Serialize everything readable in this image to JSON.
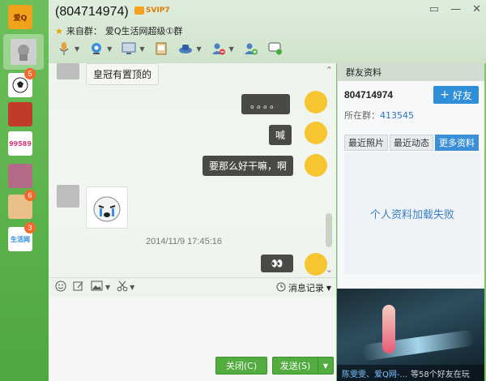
{
  "window": {
    "title": "(804714974)",
    "vip_label": "SVIP7",
    "subtitle_prefix": "来自群：",
    "subtitle_group": "爱Q生活网超级①群",
    "controls": [
      "▭",
      "—",
      "✕"
    ]
  },
  "rail": {
    "items": [
      {
        "label": "爱Q",
        "badge": ""
      },
      {
        "label": "",
        "badge": ""
      },
      {
        "label": "",
        "badge": "5"
      },
      {
        "label": "",
        "badge": ""
      },
      {
        "label": "99589",
        "badge": ""
      },
      {
        "label": "",
        "badge": ""
      },
      {
        "label": "",
        "badge": "6"
      },
      {
        "label": "生活网",
        "badge": "3"
      }
    ]
  },
  "chat": {
    "messages": [
      {
        "side": "left",
        "text": "皇冠有置顶的"
      },
      {
        "side": "right",
        "text": "。。。。"
      },
      {
        "side": "right",
        "text": "喊"
      },
      {
        "side": "right",
        "text": "要那么好干嘛，啊"
      },
      {
        "side": "right",
        "text": "👀"
      }
    ],
    "timestamp": "2014/11/9 17:45:16"
  },
  "input": {
    "history_label": "消息记录",
    "close_label": "关闭(C)",
    "send_label": "发送(S)"
  },
  "panel": {
    "header": "群友资料",
    "user_id": "804714974",
    "add_friend_label": "好友",
    "group_prefix": "所在群：",
    "group_number": "413545",
    "tabs": [
      "最近照片",
      "最近动态",
      "更多资料"
    ],
    "active_tab": 2,
    "load_fail": "个人资料加载失败"
  },
  "ad": {
    "names": "陈雯雯、爱Q网-...",
    "rest": "等58个好友在玩"
  }
}
